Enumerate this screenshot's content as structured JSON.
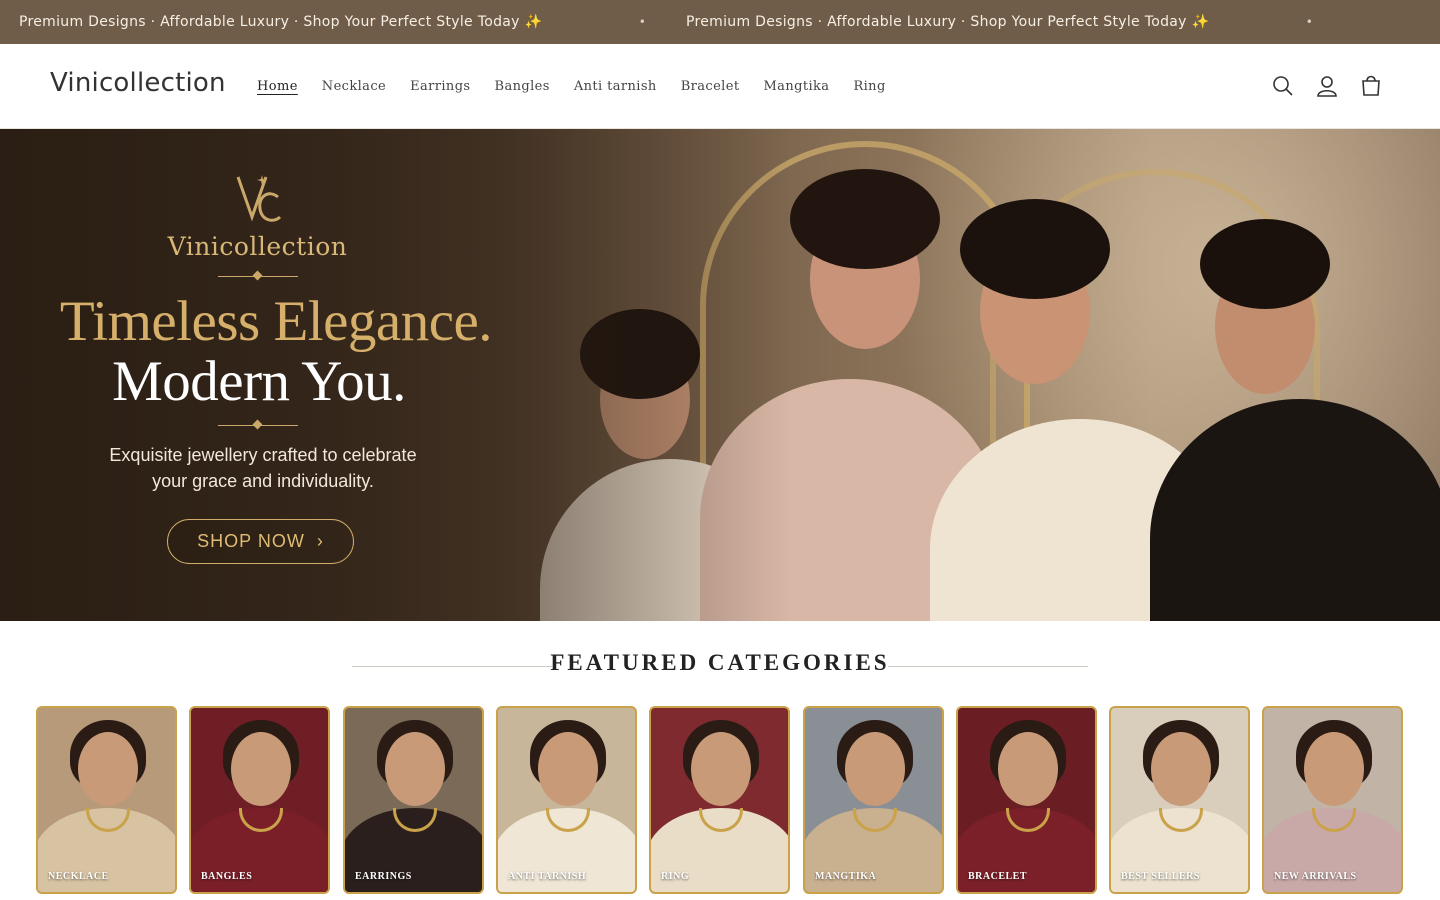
{
  "announcement": {
    "message": "Premium Designs · Affordable Luxury · Shop Your Perfect Style Today ✨",
    "separator": "•"
  },
  "header": {
    "logo": "Vinicollection",
    "nav": [
      "Home",
      "Necklace",
      "Earrings",
      "Bangles",
      "Anti tarnish",
      "Bracelet",
      "Mangtika",
      "Ring"
    ],
    "active_nav": "Home",
    "icons": [
      "search-icon",
      "account-icon",
      "cart-icon"
    ]
  },
  "hero": {
    "brand": "Vinicollection",
    "headline_line1": "Timeless Elegance.",
    "headline_line2": "Modern You.",
    "subtext_line1": "Exquisite jewellery crafted to celebrate",
    "subtext_line2": "your grace and individuality.",
    "cta": "SHOP NOW",
    "cta_chevron": "›"
  },
  "featured": {
    "title": "FEATURED CATEGORIES",
    "categories": [
      {
        "label": "NECKLACE",
        "bg": "#b79a7a",
        "body": "#d7c3a2"
      },
      {
        "label": "BANGLES",
        "bg": "#6e1e24",
        "body": "#7a1f28"
      },
      {
        "label": "EARRINGS",
        "bg": "#7b6a58",
        "body": "#2a1f1c"
      },
      {
        "label": "ANTI TARNISH",
        "bg": "#c8b69b",
        "body": "#efe6d6"
      },
      {
        "label": "RING",
        "bg": "#7e2a2e",
        "body": "#e9ddc7"
      },
      {
        "label": "MANGTIKA",
        "bg": "#8a8f96",
        "body": "#c9b08f"
      },
      {
        "label": "BRACELET",
        "bg": "#6a1d22",
        "body": "#7b2028"
      },
      {
        "label": "BEST SELLERS",
        "bg": "#d9cdbb",
        "body": "#ede2cf"
      },
      {
        "label": "NEW ARRIVALS",
        "bg": "#c1b3a6",
        "body": "#c8a9a7"
      }
    ]
  },
  "colors": {
    "announce_bg": "#6f5d49",
    "gold": "#c9a24a",
    "hero_gold_text": "#d6b06a"
  }
}
